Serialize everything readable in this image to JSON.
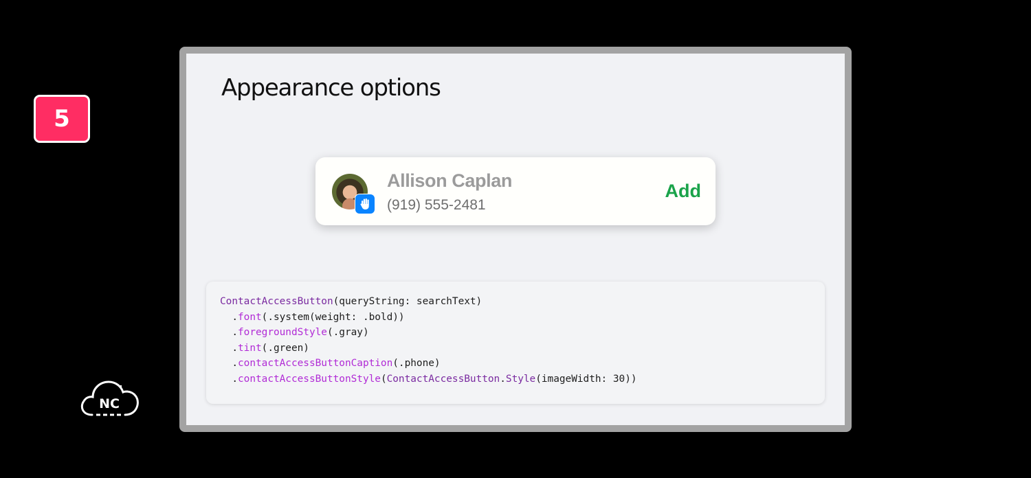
{
  "step": {
    "number": "5",
    "color": "#ff2d63"
  },
  "logo": {
    "text": "NC"
  },
  "slide": {
    "title": "Appearance options"
  },
  "contact_card": {
    "name": "Allison Caplan",
    "phone": "(919) 555-2481",
    "action_label": "Add",
    "action_color": "#1aa34a",
    "name_color": "#9b9b9b",
    "badge_icon": "hand-raised-icon",
    "badge_color": "#0a84ff"
  },
  "code": {
    "lines": [
      [
        {
          "t": "type",
          "s": "ContactAccessButton"
        },
        {
          "t": "plain",
          "s": "(queryString: searchText)"
        }
      ],
      [
        {
          "t": "plain",
          "s": "  ."
        },
        {
          "t": "fn",
          "s": "font"
        },
        {
          "t": "plain",
          "s": "(.system(weight: .bold))"
        }
      ],
      [
        {
          "t": "plain",
          "s": "  ."
        },
        {
          "t": "fn",
          "s": "foregroundStyle"
        },
        {
          "t": "plain",
          "s": "(.gray)"
        }
      ],
      [
        {
          "t": "plain",
          "s": "  ."
        },
        {
          "t": "fn",
          "s": "tint"
        },
        {
          "t": "plain",
          "s": "(.green)"
        }
      ],
      [
        {
          "t": "plain",
          "s": "  ."
        },
        {
          "t": "fn",
          "s": "contactAccessButtonCaption"
        },
        {
          "t": "plain",
          "s": "(.phone)"
        }
      ],
      [
        {
          "t": "plain",
          "s": "  ."
        },
        {
          "t": "fn",
          "s": "contactAccessButtonStyle"
        },
        {
          "t": "plain",
          "s": "("
        },
        {
          "t": "type",
          "s": "ContactAccessButton"
        },
        {
          "t": "plain",
          "s": "."
        },
        {
          "t": "type",
          "s": "Style"
        },
        {
          "t": "plain",
          "s": "(imageWidth: 30))"
        }
      ]
    ]
  }
}
